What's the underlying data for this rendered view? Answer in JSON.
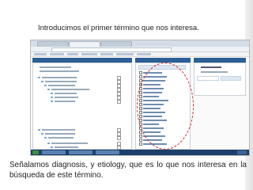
{
  "captions": {
    "top": "Introducimos el primer término que nos interesa.",
    "bottom": "Señalamos diagnosis, y etiology, que es lo que nos interesa en la búsqueda de este término."
  },
  "colors": {
    "accent_red": "#d02b2b",
    "panel_header": "#2c5f95",
    "taskbar": "#1e3f6a"
  }
}
